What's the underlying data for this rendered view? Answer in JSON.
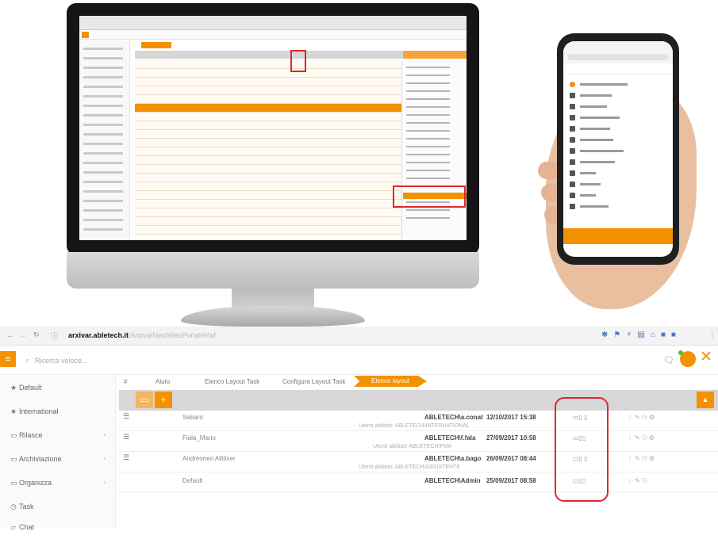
{
  "colors": {
    "accent": "#f39200",
    "highlight_border": "#e0262c"
  },
  "browser": {
    "back_icon": "back-arrow-icon",
    "forward_icon": "forward-arrow-icon",
    "reload_icon": "reload-icon",
    "url_host": "arxivar.abletech.it",
    "url_path": "/ArxivarNextWebPortal/#/wf"
  },
  "app_header": {
    "search_placeholder": "Ricerca veloce..."
  },
  "sidebar": {
    "items": [
      {
        "label": "Default",
        "icon": "star-icon",
        "has_children": false
      },
      {
        "label": "International",
        "icon": "star-icon",
        "has_children": false
      },
      {
        "label": "Rilasce",
        "icon": "folder-icon",
        "has_children": true
      },
      {
        "label": "Archiviazione",
        "icon": "folder-icon",
        "has_children": true
      },
      {
        "label": "Organizza",
        "icon": "folder-icon",
        "has_children": true
      },
      {
        "label": "Task",
        "icon": "task-icon",
        "has_children": false
      },
      {
        "label": "Chat",
        "icon": "chat-icon",
        "has_children": false
      }
    ]
  },
  "breadcrumb": {
    "hash": "#",
    "items": [
      "Aiuto",
      "Elenco Layout Task",
      "Configura Layout Task"
    ],
    "active": "Elenco layout"
  },
  "toolbar": {
    "add_symbol": "+",
    "export_symbol": "▲"
  },
  "layouts": [
    {
      "name": "Sebaro",
      "user": "ABLETECH\\a.conat",
      "date": "12/10/2017 15:38",
      "devices": "▭▯ ▯",
      "note": "Utenti abilitati: ABLETECH\\INTERNATIONAL",
      "has_drag": true
    },
    {
      "name": "Fiala_Mario",
      "user": "ABLETECH\\f.fala",
      "date": "27/09/2017 10:58",
      "devices": "▭▯▯",
      "note": "Utenti abilitati: ABLETECH\\FMA",
      "has_drag": true
    },
    {
      "name": "Andreoneo Allitixer",
      "user": "ABLETECH\\a.bago",
      "date": "26/09/2017 08:44",
      "devices": "▭▯ ▯",
      "note": "Utenti abilitati: ABLETECH\\ASSISTENTE",
      "has_drag": true
    },
    {
      "name": "Default",
      "user": "ABLETECH\\Admin",
      "date": "25/09/2017 08:58",
      "devices": "▭▯▯",
      "note": "",
      "has_drag": false
    }
  ]
}
